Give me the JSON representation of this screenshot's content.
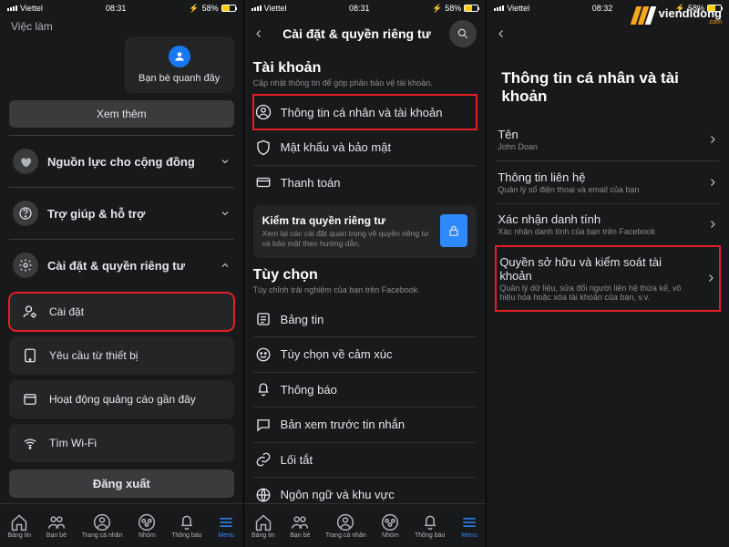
{
  "status": {
    "carrier": "Viettel",
    "time1": "08:31",
    "time2": "08:31",
    "time3": "08:32",
    "battery": "58%"
  },
  "watermark": {
    "text": "viendidong",
    "com": ".com"
  },
  "panel1": {
    "jobs": "Việc làm",
    "nearby": "Bạn bè quanh đây",
    "more": "Xem thêm",
    "community": "Nguồn lực cho cộng đồng",
    "help": "Trợ giúp & hỗ trợ",
    "settings_privacy": "Cài đặt & quyền riêng tư",
    "settings": "Cài đặt",
    "device_requests": "Yêu cầu từ thiết bị",
    "recent_ads": "Hoạt động quảng cáo gần đây",
    "find_wifi": "Tìm Wi-Fi",
    "logout": "Đăng xuất"
  },
  "panel2": {
    "title": "Cài đặt & quyền riêng tư",
    "account": "Tài khoản",
    "account_sub": "Cập nhật thông tin để góp phần bảo vệ tài khoản.",
    "personal_info": "Thông tin cá nhân và tài khoản",
    "password": "Mật khẩu và bảo mật",
    "payments": "Thanh toán",
    "privacy_check_title": "Kiểm tra quyền riêng tư",
    "privacy_check_sub": "Xem lại các cài đặt quan trọng về quyền riêng tư và bảo mật theo hướng dẫn.",
    "prefs": "Tùy chọn",
    "prefs_sub": "Tùy chỉnh trải nghiệm của bạn trên Facebook.",
    "feed": "Bảng tin",
    "reactions": "Tùy chọn về cảm xúc",
    "notifications": "Thông báo",
    "message_preview": "Bản xem trước tin nhắn",
    "shortcuts": "Lối tắt",
    "language": "Ngôn ngữ và khu vực"
  },
  "panel3": {
    "title": "Thông tin cá nhân và tài khoản",
    "name_label": "Tên",
    "name_value": "John Doan",
    "contact_label": "Thông tin liên hệ",
    "contact_sub": "Quản lý số điện thoại và email của bạn",
    "identity_label": "Xác nhận danh tính",
    "identity_sub": "Xác nhận danh tính của bạn trên Facebook",
    "ownership_label": "Quyền sở hữu và kiểm soát tài khoản",
    "ownership_sub": "Quản lý dữ liệu, sửa đổi người liên hệ thừa kế, vô hiệu hóa hoặc xóa tài khoản của bạn, v.v."
  },
  "nav": {
    "feed": "Bảng tin",
    "friends": "Bạn bè",
    "profile": "Trang cá nhân",
    "groups": "Nhóm",
    "notifs": "Thông báo",
    "menu": "Menu"
  }
}
